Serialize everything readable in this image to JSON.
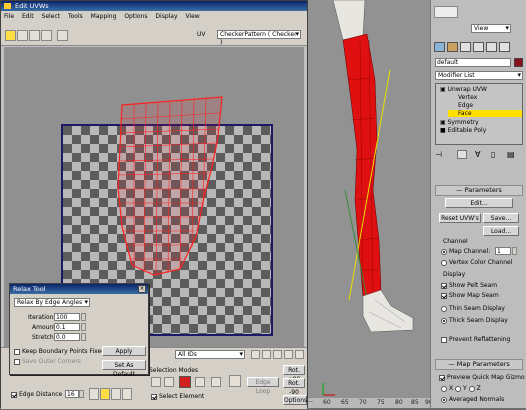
{
  "window": {
    "title": "Edit UVWs"
  },
  "menubar": [
    "File",
    "Edit",
    "Select",
    "Tools",
    "Mapping",
    "Options",
    "Display",
    "View"
  ],
  "toolbar": {
    "uv_label": "UV",
    "texture": "CheckerPattern  ( Checker )"
  },
  "relax_tool": {
    "title": "Relax Tool",
    "mode": "Relax By Edge Angles",
    "iterations_label": "Iterations:",
    "iterations": "100",
    "amount_label": "Amount:",
    "amount": "0.1",
    "stretch_label": "Stretch:",
    "stretch": "0.0",
    "keep_boundary": "Keep Boundary Points Fixed",
    "save_corners": "Save Outer Corners",
    "apply": "Apply",
    "set_default": "Set As Default"
  },
  "bottom": {
    "ids": "All IDs",
    "selection_modes": "Selection Modes",
    "edge_loop": "Edge Loop",
    "select_element": "Select Element",
    "edge_distance": "Edge Distance",
    "edge_distance_value": "16",
    "rot_pos": "Rot. +90",
    "rot_neg": "Rot. -90",
    "options": "Options..."
  },
  "ruler": [
    "60",
    "65",
    "70",
    "75",
    "80",
    "85",
    "90"
  ],
  "panel": {
    "view": "View",
    "object_name": "default",
    "modifier_list": "Modifier List",
    "stack": [
      {
        "label": "Unwrap UVW"
      },
      {
        "label": "Vertex"
      },
      {
        "label": "Edge"
      },
      {
        "label": "Face"
      },
      {
        "label": "Symmetry"
      },
      {
        "label": "Editable Poly"
      }
    ],
    "parameters": "Parameters",
    "edit": "Edit...",
    "reset_uvws": "Reset UVW's",
    "save": "Save...",
    "load": "Load...",
    "channel": "Channel",
    "map_channel": "Map Channel:",
    "map_channel_value": "1",
    "vertex_color_channel": "Vertex Color Channel",
    "display": "Display",
    "show_pelt_seam": "Show Pelt Seam",
    "show_map_seam": "Show Map Seam",
    "thin_seam": "Thin Seam Display",
    "thick_seam": "Thick Seam Display",
    "prevent_reflattening": "Prevent Reflattening",
    "map_parameters": "Map Parameters",
    "preview_gizmo": "Preview Quick Map Gizmo",
    "axis_x": "X",
    "axis_y": "Y",
    "axis_z": "Z",
    "averaged_normals": "Averaged Normals"
  },
  "colors": {
    "mesh": "#ff2020",
    "selected": "#ffe000",
    "titlebar": "#0a246a"
  }
}
